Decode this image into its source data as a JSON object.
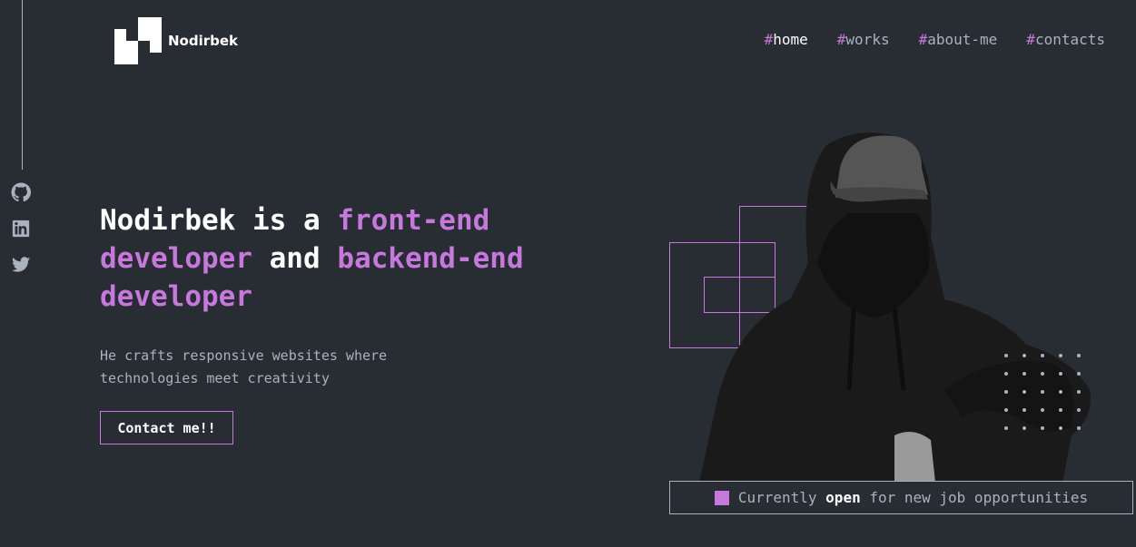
{
  "brand": {
    "name": "Nodirbek"
  },
  "nav": {
    "items": [
      {
        "hash": "#",
        "label": "home",
        "active": true
      },
      {
        "hash": "#",
        "label": "works",
        "active": false
      },
      {
        "hash": "#",
        "label": "about-me",
        "active": false
      },
      {
        "hash": "#",
        "label": "contacts",
        "active": false
      }
    ]
  },
  "social": [
    "github-icon",
    "linkedin-icon",
    "twitter-icon"
  ],
  "hero": {
    "title_part1": "Nodirbek is a ",
    "title_accent1": "front-end developer",
    "title_part2": " and ",
    "title_accent2": "backend-end developer",
    "subtitle": "He crafts responsive websites where technologies meet creativity",
    "cta_label": "Contact me!!"
  },
  "status": {
    "prefix": "Currently ",
    "highlight": "open",
    "suffix": " for new job opportunities"
  },
  "colors": {
    "background": "#282c33",
    "accent": "#c778dd",
    "muted_text": "#abb2bf",
    "text": "#ffffff"
  }
}
